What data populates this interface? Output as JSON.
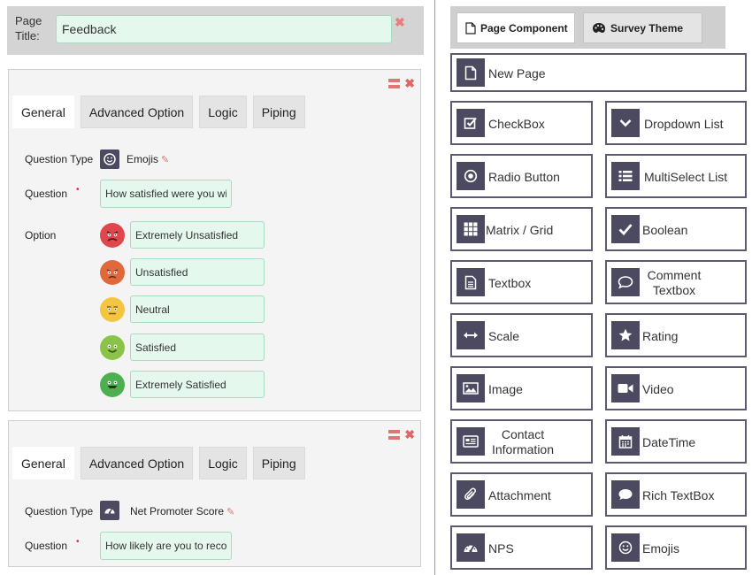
{
  "page": {
    "title_label": "Page\nTitle:",
    "title_value": "Feedback"
  },
  "tabs": [
    "General",
    "Advanced Option",
    "Logic",
    "Piping"
  ],
  "question1": {
    "type_label": "Question Type",
    "type_value": "Emojis",
    "question_label": "Question",
    "question_value": "How satisfied were you with",
    "option_label": "Option",
    "options": [
      "Extremely Unsatisfied",
      "Unsatisfied",
      "Neutral",
      "Satisfied",
      "Extremely Satisfied"
    ]
  },
  "question2": {
    "type_label": "Question Type",
    "type_value": "Net Promoter Score",
    "question_label": "Question",
    "question_value": "How likely are you to recomr"
  },
  "component_tabs": {
    "page_component": "Page Component",
    "survey_theme": "Survey Theme"
  },
  "components": {
    "new_page": "New Page",
    "checkbox": "CheckBox",
    "dropdown": "Dropdown List",
    "radio": "Radio Button",
    "multiselect": "MultiSelect List",
    "matrix": "Matrix / Grid",
    "boolean": "Boolean",
    "textbox": "Textbox",
    "comment": "Comment\nTextbox",
    "scale": "Scale",
    "rating": "Rating",
    "image": "Image",
    "video": "Video",
    "contact": "Contact\nInformation",
    "datetime": "DateTime",
    "attachment": "Attachment",
    "rich_textbox": "Rich TextBox",
    "nps": "NPS",
    "emojis": "Emojis"
  },
  "colors": {
    "input_bg": "#e5f8ee",
    "icon_bg": "#4b4a61",
    "danger": "#e57373",
    "emoji_red": "#e0474c",
    "emoji_orange": "#e1683a",
    "emoji_yellow": "#f4c542",
    "emoji_lightgreen": "#8bc34a",
    "emoji_green": "#4caf50"
  }
}
